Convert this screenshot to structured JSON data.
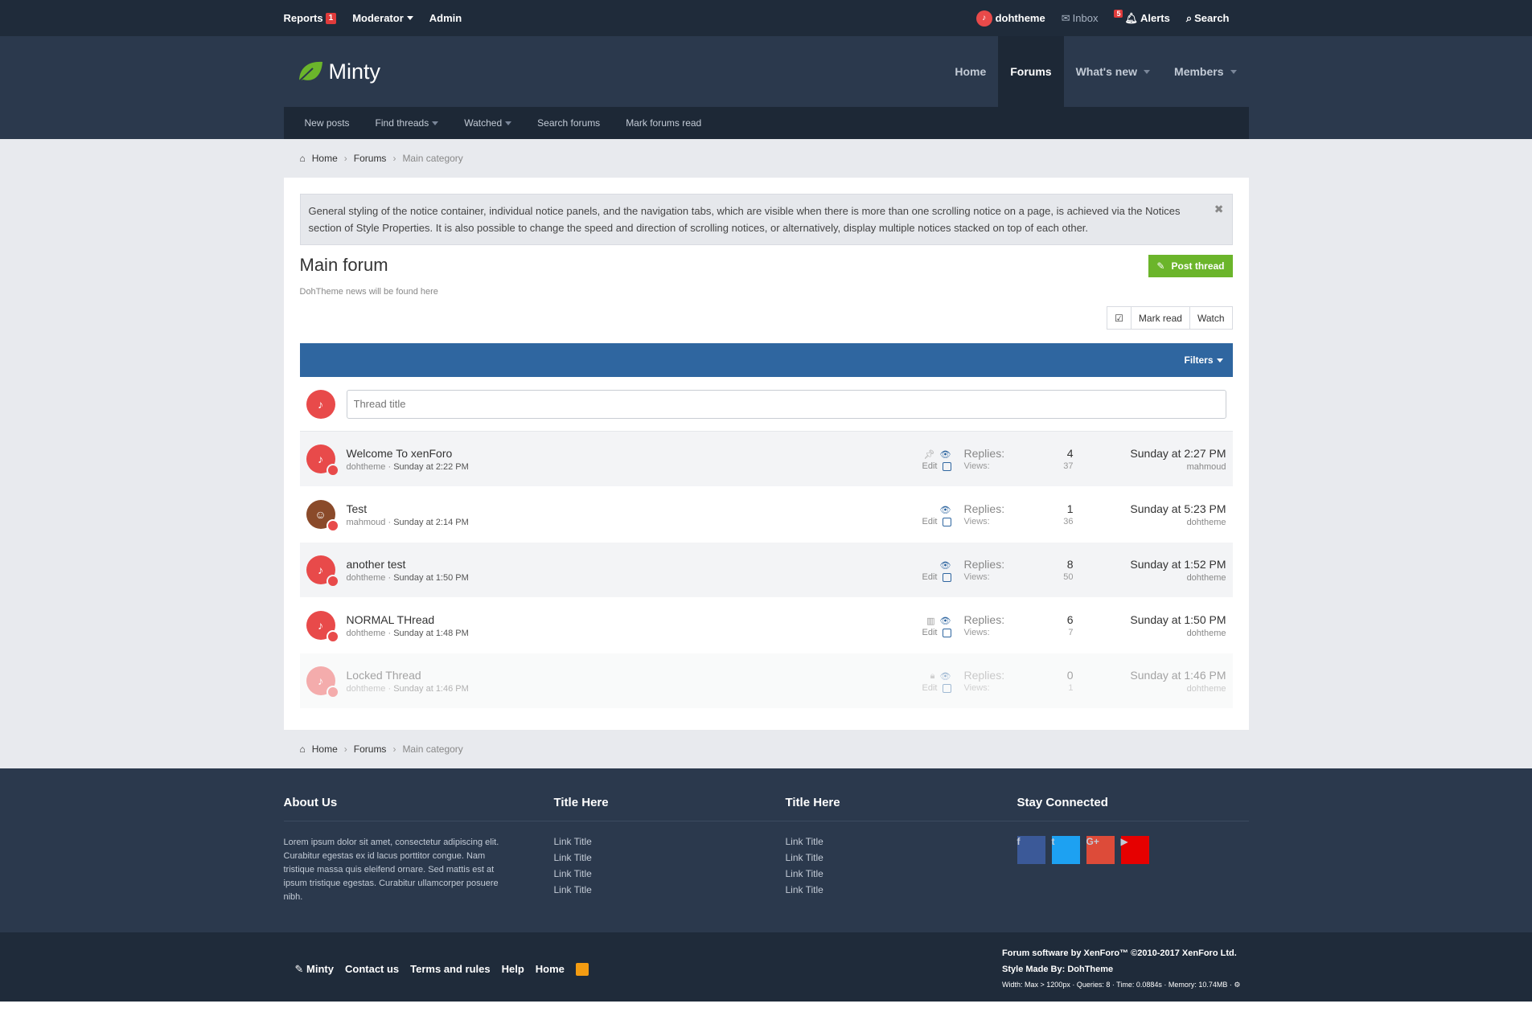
{
  "modbar": {
    "reports": "Reports",
    "reports_count": "1",
    "moderator": "Moderator",
    "admin": "Admin",
    "username": "dohtheme",
    "inbox": "Inbox",
    "alerts": "Alerts",
    "alerts_count": "5",
    "search": "Search"
  },
  "header": {
    "logo": "Minty",
    "nav": [
      "Home",
      "Forums",
      "What's new",
      "Members"
    ],
    "subnav": [
      "New posts",
      "Find threads",
      "Watched",
      "Search forums",
      "Mark forums read"
    ]
  },
  "breadcrumb": [
    "Home",
    "Forums",
    "Main category"
  ],
  "notice": "General styling of the notice container, individual notice panels, and the navigation tabs, which are visible when there is more than one scrolling notice on a page, is achieved via the Notices section of Style Properties. It is also possible to change the speed and direction of scrolling notices, or alternatively, display multiple notices stacked on top of each other.",
  "forum": {
    "title": "Main forum",
    "description": "DohTheme news will be found here",
    "post_thread": "Post thread",
    "mark_read": "Mark read",
    "watch": "Watch",
    "filters": "Filters",
    "thread_title_placeholder": "Thread title"
  },
  "threads": [
    {
      "title": "Welcome To xenForo",
      "author": "dohtheme",
      "date": "Sunday at 2:22 PM",
      "replies_label": "Replies:",
      "replies": "4",
      "views_label": "Views:",
      "views": "37",
      "last_date": "Sunday at 2:27 PM",
      "last_user": "mahmoud",
      "edit": "Edit",
      "status_icon": "pin-icon"
    },
    {
      "title": "Test",
      "author": "mahmoud",
      "date": "Sunday at 2:14 PM",
      "replies_label": "Replies:",
      "replies": "1",
      "views_label": "Views:",
      "views": "36",
      "last_date": "Sunday at 5:23 PM",
      "last_user": "dohtheme",
      "edit": "Edit",
      "status_icon": ""
    },
    {
      "title": "another test",
      "author": "dohtheme",
      "date": "Sunday at 1:50 PM",
      "replies_label": "Replies:",
      "replies": "8",
      "views_label": "Views:",
      "views": "50",
      "last_date": "Sunday at 1:52 PM",
      "last_user": "dohtheme",
      "edit": "Edit",
      "status_icon": ""
    },
    {
      "title": "NORMAL THread",
      "author": "dohtheme",
      "date": "Sunday at 1:48 PM",
      "replies_label": "Replies:",
      "replies": "6",
      "views_label": "Views:",
      "views": "7",
      "last_date": "Sunday at 1:50 PM",
      "last_user": "dohtheme",
      "edit": "Edit",
      "status_icon": "poll-icon"
    },
    {
      "title": "Locked Thread",
      "author": "dohtheme",
      "date": "Sunday at 1:46 PM",
      "replies_label": "Replies:",
      "replies": "0",
      "views_label": "Views:",
      "views": "1",
      "last_date": "Sunday at 1:46 PM",
      "last_user": "dohtheme",
      "edit": "Edit",
      "status_icon": "lock-icon"
    }
  ],
  "footer": {
    "about_title": "About Us",
    "about_text": "Lorem ipsum dolor sit amet, consectetur adipiscing elit. Curabitur egestas ex id lacus porttitor congue. Nam tristique massa quis eleifend ornare. Sed mattis est at ipsum tristique egestas. Curabitur ullamcorper posuere nibh.",
    "col2_title": "Title Here",
    "col2_links": [
      "Link Title",
      "Link Title",
      "Link Title",
      "Link Title"
    ],
    "col3_title": "Title Here",
    "col3_links": [
      "Link Title",
      "Link Title",
      "Link Title",
      "Link Title"
    ],
    "stay_title": "Stay Connected",
    "socials": [
      {
        "name": "facebook-icon",
        "glyph": "f",
        "color": "#3b5998"
      },
      {
        "name": "twitter-icon",
        "glyph": "t",
        "color": "#1da1f2"
      },
      {
        "name": "google-plus-icon",
        "glyph": "G+",
        "color": "#dd4b39"
      },
      {
        "name": "youtube-icon",
        "glyph": "▶",
        "color": "#e60000"
      }
    ]
  },
  "copyright": {
    "links": [
      "Minty",
      "Contact us",
      "Terms and rules",
      "Help",
      "Home"
    ],
    "line1": "Forum software by XenForo™ ©2010-2017 XenForo Ltd.",
    "line2": "Style Made By: DohTheme",
    "line3": "Width: Max > 1200px · Queries: 8 · Time: 0.0884s · Memory: 10.74MB ·"
  },
  "colors": {
    "brand_green": "#6bb52b",
    "filter_blue": "#2f66a0",
    "header_dark": "#2b394d",
    "avatar_red": "#e84a4a"
  }
}
